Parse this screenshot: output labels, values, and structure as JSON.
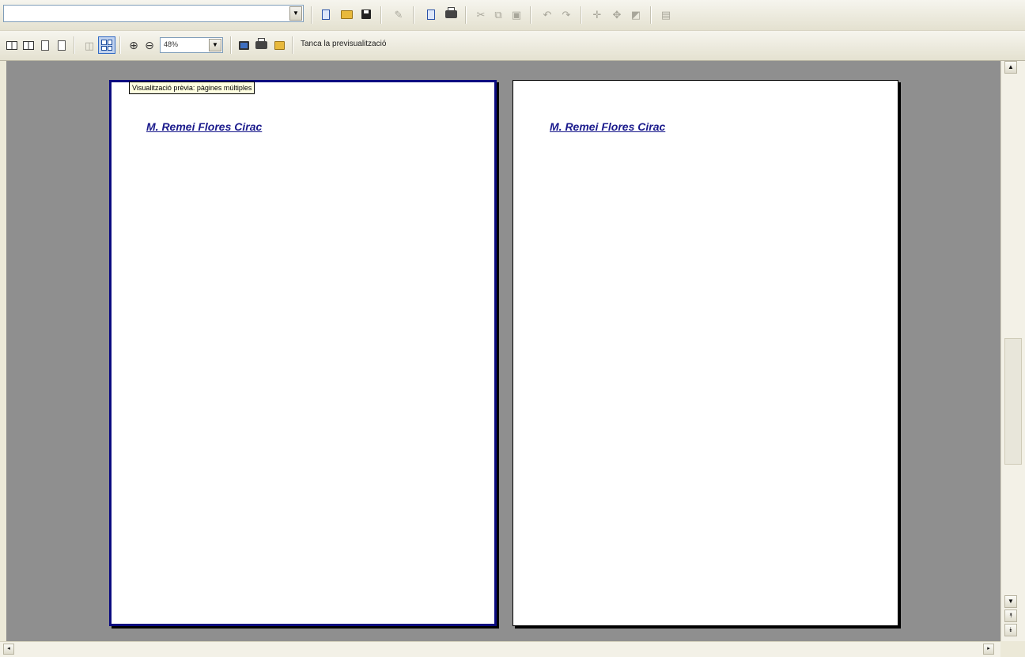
{
  "toolbar_top": {
    "style_combo_value": "",
    "buttons": [
      "new-document-icon",
      "open-folder-icon",
      "save-disk-icon",
      "edit-file-icon",
      "export-pdf-icon",
      "print-icon",
      "cut-icon",
      "copy-icon",
      "paste-icon",
      "undo-icon",
      "redo-icon",
      "hyperlink-icon",
      "navigator-icon",
      "gallery-icon",
      "table-icon"
    ]
  },
  "toolbar_preview": {
    "zoom_value": "48%",
    "close_label": "Tanca la previsualització",
    "buttons": [
      "first-page-icon",
      "previous-page-icon",
      "next-page-icon",
      "last-page-icon",
      "two-pages-icon",
      "multiple-pages-icon",
      "zoom-in-icon",
      "zoom-out-icon",
      "full-screen-icon",
      "print-preview-icon",
      "print-options-icon"
    ],
    "active_button": "multiple-pages-icon"
  },
  "tooltip": {
    "text": "Visualització prèvia: pàgines múltiples"
  },
  "pages": [
    {
      "header": "M. Remei Flores Cirac"
    },
    {
      "header": "M. Remei Flores Cirac"
    }
  ],
  "scrollbar": {
    "up_arrow": "▲",
    "down_arrow": "▼",
    "prev_page_arrow": "⯭",
    "next_page_arrow": "⯯",
    "left_arrow": "◂",
    "right_arrow": "▸"
  },
  "colors": {
    "workspace_bg": "#8f8f8f",
    "page_header": "#1a1a8c",
    "selected_page_border": "#0b0b80",
    "tooltip_bg": "#ffffe1"
  }
}
